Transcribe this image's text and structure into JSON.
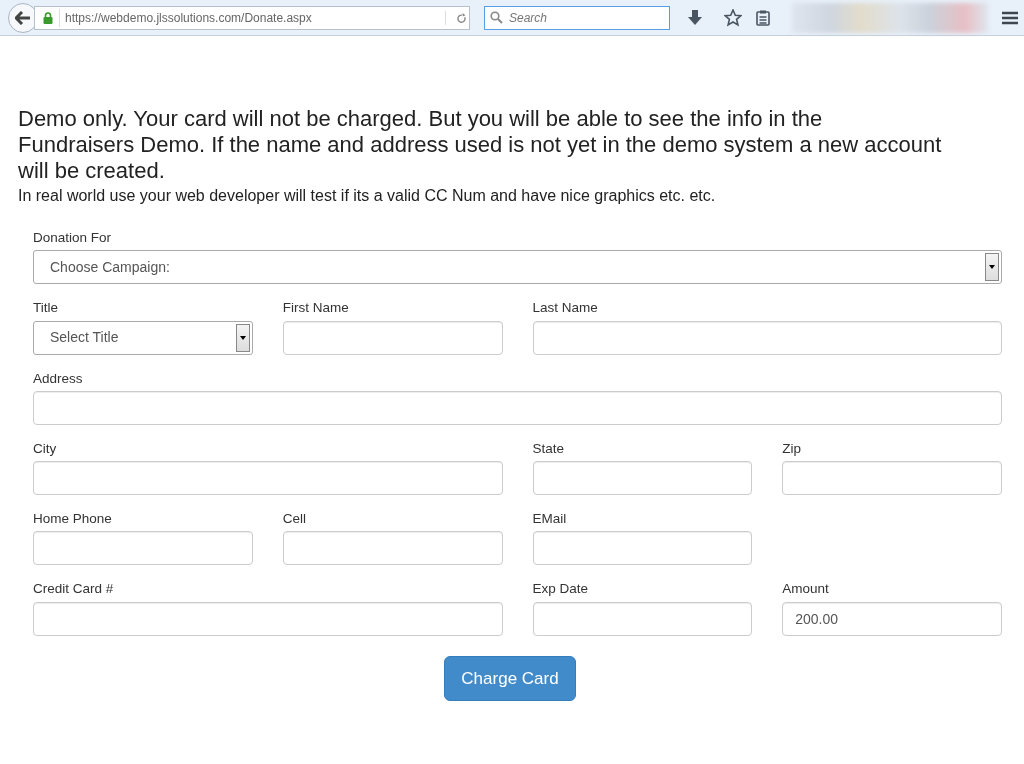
{
  "browser": {
    "url": "https://webdemo.jlssolutions.com/Donate.aspx",
    "search": {
      "placeholder": "Search"
    }
  },
  "notice": {
    "headline": "Demo only. Your card will not be charged. But you will be able to see the info in the Fundraisers Demo. If the name and address used is not yet in the demo system a new account will be created.",
    "subline": "In real world use your web developer will test if its a valid CC Num and have nice graphics etc. etc."
  },
  "form": {
    "rows": [
      [
        {
          "kind": "select",
          "label": "Donation For",
          "value": "Choose Campaign:"
        }
      ],
      [
        {
          "kind": "select",
          "label": "Title",
          "value": "Select Title"
        },
        {
          "kind": "text",
          "label": "First Name"
        },
        {
          "kind": "text",
          "label": "Last Name"
        }
      ],
      [
        {
          "kind": "text",
          "label": "Address"
        }
      ],
      [
        {
          "kind": "text",
          "label": "City"
        },
        {
          "kind": "text",
          "label": "State"
        },
        {
          "kind": "text",
          "label": "Zip"
        }
      ],
      [
        {
          "kind": "text",
          "label": "Home Phone"
        },
        {
          "kind": "text",
          "label": "Cell"
        },
        {
          "kind": "text",
          "label": "EMail"
        }
      ],
      [
        {
          "kind": "text",
          "label": "Credit Card #"
        },
        {
          "kind": "text",
          "label": "Exp Date"
        },
        {
          "kind": "text",
          "label": "Amount",
          "value": "200.00"
        }
      ]
    ],
    "submit": "Charge Card"
  }
}
